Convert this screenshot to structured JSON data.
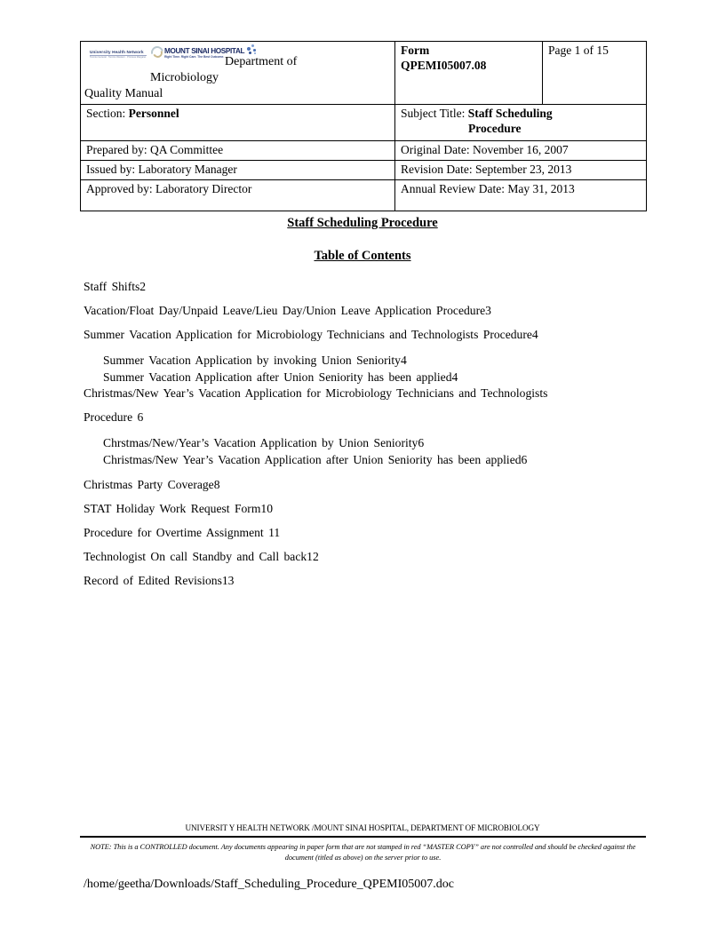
{
  "header_table": {
    "logo": {
      "uhn_name": "University Health Network",
      "uhn_tagline": "Toronto General · Toronto Western · Princess Margaret",
      "msh_name": "MOUNT SINAI HOSPITAL",
      "msh_tagline": "Right Time. Right Care. The Best Outcome.",
      "swirl_icon": "swirl-logo-icon",
      "sparkle_icon": "sparkle-logo-icon"
    },
    "department_label": "Department of",
    "department_name": "Microbiology",
    "quality_manual": "Quality Manual",
    "form_label": "Form",
    "form_number": "QPEMI05007.08",
    "page_label": "Page  1 of 15",
    "section_label": "Section:",
    "section_value": "Personnel",
    "subject_label": "Subject Title:",
    "subject_value_line1": "Staff Scheduling",
    "subject_value_line2": "Procedure",
    "prepared_by": "Prepared by: QA Committee",
    "original_date": "Original Date: November 16, 2007",
    "issued_by": "Issued by: Laboratory Manager",
    "revision_date": "Revision Date: September 23, 2013",
    "approved_by": "Approved by: Laboratory Director",
    "annual_review_date": "Annual Review Date: May 31, 2013"
  },
  "body": {
    "doc_title": "Staff Scheduling Procedure",
    "toc_title": "Table of Contents",
    "toc": [
      {
        "text": "Staff  Shifts2",
        "level": 0
      },
      {
        "text": "Vacation/Float  Day/Unpaid  Leave/Lieu  Day/Union  Leave  Application  Procedure3",
        "level": 0
      },
      {
        "text": "Summer  Vacation  Application  for  Microbiology  Technicians  and  Technologists  Procedure4",
        "level": 0
      },
      {
        "text": "Summer  Vacation  Application  by invoking  Union  Seniority4",
        "level": 1
      },
      {
        "text": "Summer  Vacation  Application  after  Union  Seniority  has  been  applied4",
        "level": 1
      },
      {
        "text": "Christmas/New  Year’s  Vacation  Application  for  Microbiology  Technicians  and  Technologists",
        "line2": "Procedure   6",
        "level": 0
      },
      {
        "text": "Chrstmas/New/Year’s  Vacation  Application  by  Union  Seniority6",
        "level": 1
      },
      {
        "text": "Christmas/New  Year’s  Vacation  Application  after  Union  Seniority  has  been  applied6",
        "level": 1
      },
      {
        "text": "Christmas  Party  Coverage8",
        "level": 0
      },
      {
        "text": "STAT  Holiday  Work  Request  Form10",
        "level": 0
      },
      {
        "text": "Procedure  for  Overtime  Assignment 11",
        "level": 0
      },
      {
        "text": "Technologist  On call  Standby  and  Call  back12",
        "level": 0
      },
      {
        "text": "Record  of  Edited  Revisions13",
        "level": 0
      }
    ]
  },
  "footer": {
    "organization": "UNIVERSIT Y HEALTH NETWORK /MOUNT SINAI HOSPITAL, DEPARTMENT OF MICROBIOLOGY",
    "note_line1": "NOTE: This is a CONTROLLED document. Any documents appearing in paper form that are not stamped in red “MASTER COPY” are not",
    "note_line2": "controlled and should be checked against the document (titled as above) on the server prior to use.",
    "file_path": "/home/geetha/Downloads/Staff_Scheduling_Procedure_QPEMI05007.doc"
  }
}
